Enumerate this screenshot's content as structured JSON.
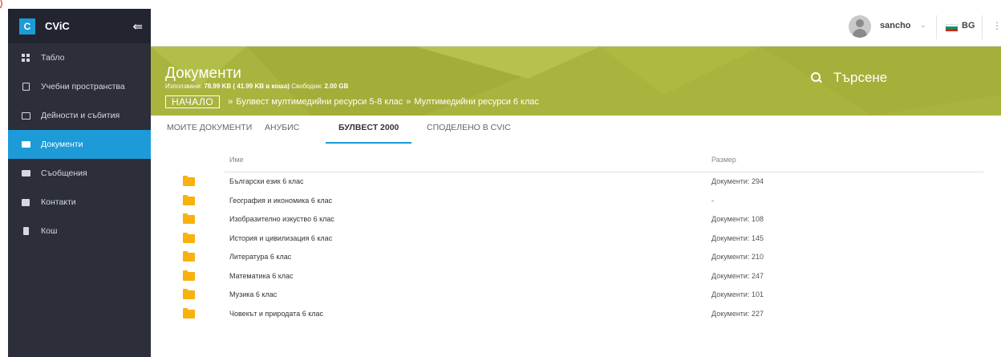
{
  "colors": {
    "sidebar_bg": "#2c2f3a",
    "accent": "#1d9bd8",
    "header_bg": "#a9b43e",
    "folder": "#f9b10e"
  },
  "sidebar": {
    "brand_letter": "C",
    "brand_name": "CViC",
    "collapse_icon": "⇚",
    "items": [
      {
        "label": "Табло",
        "icon": "dashboard-icon",
        "active": false
      },
      {
        "label": "Учебни пространства",
        "icon": "building-icon",
        "active": false
      },
      {
        "label": "Дейности и събития",
        "icon": "calendar-icon",
        "active": false
      },
      {
        "label": "Документи",
        "icon": "folder-icon",
        "active": true
      },
      {
        "label": "Съобщения",
        "icon": "mail-icon",
        "active": false
      },
      {
        "label": "Контакти",
        "icon": "contact-card-icon",
        "active": false
      },
      {
        "label": "Кош",
        "icon": "trash-icon",
        "active": false
      }
    ]
  },
  "topbar": {
    "username": "sancho",
    "user_caret": "⌄",
    "language": "BG",
    "apps_icon": "⋮⋮"
  },
  "header": {
    "title": "Документи",
    "usage": {
      "used_label": "Използвани:",
      "used_value": "78.99 KB ( 41.99 KB в коша)",
      "free_label": "Свободни:",
      "free_value": "2.00 GB"
    },
    "breadcrumbs": {
      "home": "НАЧАЛО",
      "separator": "»",
      "items": [
        "Булвест мултимедийни ресурси 5-8 клас",
        "Мултимедийни ресурси 6 клас"
      ]
    },
    "search_placeholder": "Търсене"
  },
  "tabs": [
    {
      "label": "Моите документи",
      "active": false
    },
    {
      "label": "Анубис",
      "active": false
    },
    {
      "label": "Булвест 2000",
      "active": true
    },
    {
      "label": "Споделено в CViC",
      "active": false
    }
  ],
  "table": {
    "columns": [
      "Име",
      "Размер"
    ],
    "rows": [
      {
        "name": "Български език 6 клас",
        "size": "Документи: 294"
      },
      {
        "name": "География и икономика 6 клас",
        "size": "-"
      },
      {
        "name": "Изобразително изкуство 6 клас",
        "size": "Документи: 108"
      },
      {
        "name": "История и цивилизация 6 клас",
        "size": "Документи: 145"
      },
      {
        "name": "Литература 6 клас",
        "size": "Документи: 210"
      },
      {
        "name": "Математика 6 клас",
        "size": "Документи: 247"
      },
      {
        "name": "Музика 6 клас",
        "size": "Документи: 101"
      },
      {
        "name": "Човекът и природата 6 клас",
        "size": "Документи: 227"
      }
    ]
  }
}
